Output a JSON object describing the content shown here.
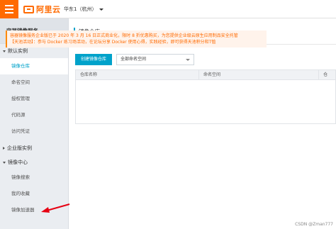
{
  "header": {
    "logo_text": "阿里云",
    "region": "华东1（杭州）"
  },
  "sidebar": {
    "title": "容器镜像服务",
    "groups": [
      {
        "label": "默认实例",
        "expanded": true,
        "items": [
          "镜像仓库",
          "命名空间",
          "授权管理",
          "代码源",
          "访问凭证"
        ]
      },
      {
        "label": "企业版实例",
        "expanded": false,
        "items": []
      },
      {
        "label": "镜像中心",
        "expanded": true,
        "items": [
          "镜像搜索",
          "我的收藏",
          "镜像加速器"
        ]
      }
    ],
    "active_item": "镜像仓库"
  },
  "main": {
    "title": "镜像仓库",
    "notice_line1": "容器镜像服务企业版已于 2020 年 3 月 16 日正式商业化，限时 8 折优惠购买，为您提供企业级云原生应用制品安全托管",
    "notice_line2": "【天池活动】：参与 Docker 练习场活动，在论坛分享 Docker 使用心得，实践经验，即可获得天池积分和T恤",
    "create_button": "创建镜像仓库",
    "namespace_select": "全部命名空间",
    "table": {
      "columns": [
        "仓库名称",
        "命名空间",
        "仓"
      ]
    }
  },
  "watermark": "CSDN @Zman777",
  "colors": {
    "brand_orange": "#ff6a00",
    "accent_blue": "#00a2ca",
    "arrow_red": "#e60012"
  }
}
